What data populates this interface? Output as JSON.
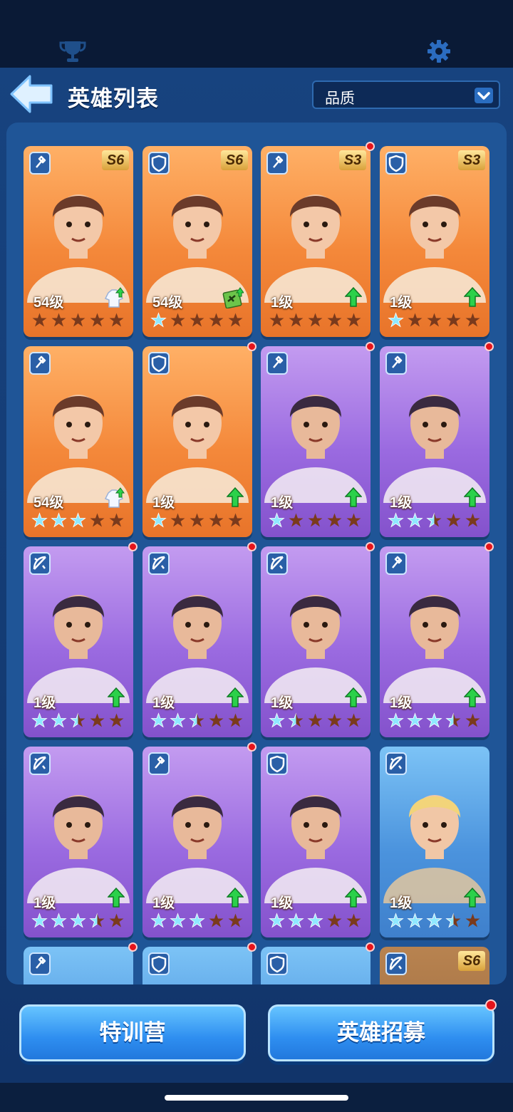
{
  "header": {
    "title": "英雄列表",
    "filter_label": "品质"
  },
  "icons": {
    "top_left": "trophy-icon",
    "top_right": "gear-icon",
    "back": "back-arrow-icon",
    "dropdown": "chevron-down-icon"
  },
  "colors": {
    "star_filled": "#8fe8ff",
    "star_empty": "#7a3a1c",
    "notify": "#e5141b"
  },
  "heroes": [
    {
      "tier": "orange",
      "role": "staff",
      "grade": "S6",
      "level": "54级",
      "stars": 0,
      "dot": false,
      "extra": "costume"
    },
    {
      "tier": "orange",
      "role": "shield",
      "grade": "S6",
      "level": "54级",
      "stars": 1,
      "dot": false,
      "extra": "book"
    },
    {
      "tier": "orange",
      "role": "staff",
      "grade": "S3",
      "level": "1级",
      "stars": 0,
      "dot": true,
      "extra": "arrow"
    },
    {
      "tier": "orange",
      "role": "shield",
      "grade": "S3",
      "level": "1级",
      "stars": 1,
      "dot": false,
      "extra": "arrow"
    },
    {
      "tier": "orange",
      "role": "staff",
      "grade": "",
      "level": "54级",
      "stars": 3,
      "dot": false,
      "extra": "costume"
    },
    {
      "tier": "orange",
      "role": "shield",
      "grade": "",
      "level": "1级",
      "stars": 1,
      "dot": true,
      "extra": "arrow"
    },
    {
      "tier": "purple",
      "role": "staff",
      "grade": "",
      "level": "1级",
      "stars": 1,
      "dot": true,
      "extra": "arrow"
    },
    {
      "tier": "purple",
      "role": "staff",
      "grade": "",
      "level": "1级",
      "stars": 2.5,
      "dot": true,
      "extra": "arrow"
    },
    {
      "tier": "purple",
      "role": "bow",
      "grade": "",
      "level": "1级",
      "stars": 2.5,
      "dot": true,
      "extra": "arrow"
    },
    {
      "tier": "purple",
      "role": "bow",
      "grade": "",
      "level": "1级",
      "stars": 2.5,
      "dot": true,
      "extra": "arrow"
    },
    {
      "tier": "purple",
      "role": "bow",
      "grade": "",
      "level": "1级",
      "stars": 1.5,
      "dot": true,
      "extra": "arrow"
    },
    {
      "tier": "purple",
      "role": "staff",
      "grade": "",
      "level": "1级",
      "stars": 3.5,
      "dot": true,
      "extra": "arrow"
    },
    {
      "tier": "purple",
      "role": "bow",
      "grade": "",
      "level": "1级",
      "stars": 3.5,
      "dot": false,
      "extra": "arrow"
    },
    {
      "tier": "purple",
      "role": "staff",
      "grade": "",
      "level": "1级",
      "stars": 3,
      "dot": true,
      "extra": "arrow"
    },
    {
      "tier": "purple",
      "role": "shield",
      "grade": "",
      "level": "1级",
      "stars": 3,
      "dot": false,
      "extra": "arrow"
    },
    {
      "tier": "blue",
      "role": "bow",
      "grade": "",
      "level": "1级",
      "stars": 3.5,
      "dot": false,
      "extra": "arrow"
    },
    {
      "tier": "blue",
      "role": "staff",
      "grade": "",
      "level": "",
      "stars": 0,
      "dot": true,
      "extra": "none"
    },
    {
      "tier": "blue",
      "role": "shield",
      "grade": "",
      "level": "",
      "stars": 0,
      "dot": true,
      "extra": "none"
    },
    {
      "tier": "blue",
      "role": "shield",
      "grade": "",
      "level": "",
      "stars": 0,
      "dot": true,
      "extra": "none"
    },
    {
      "tier": "brown",
      "role": "bow",
      "grade": "S6",
      "level": "",
      "stars": 0,
      "dot": false,
      "extra": "none"
    }
  ],
  "buttons": {
    "training": "特训营",
    "recruit": "英雄招募"
  }
}
